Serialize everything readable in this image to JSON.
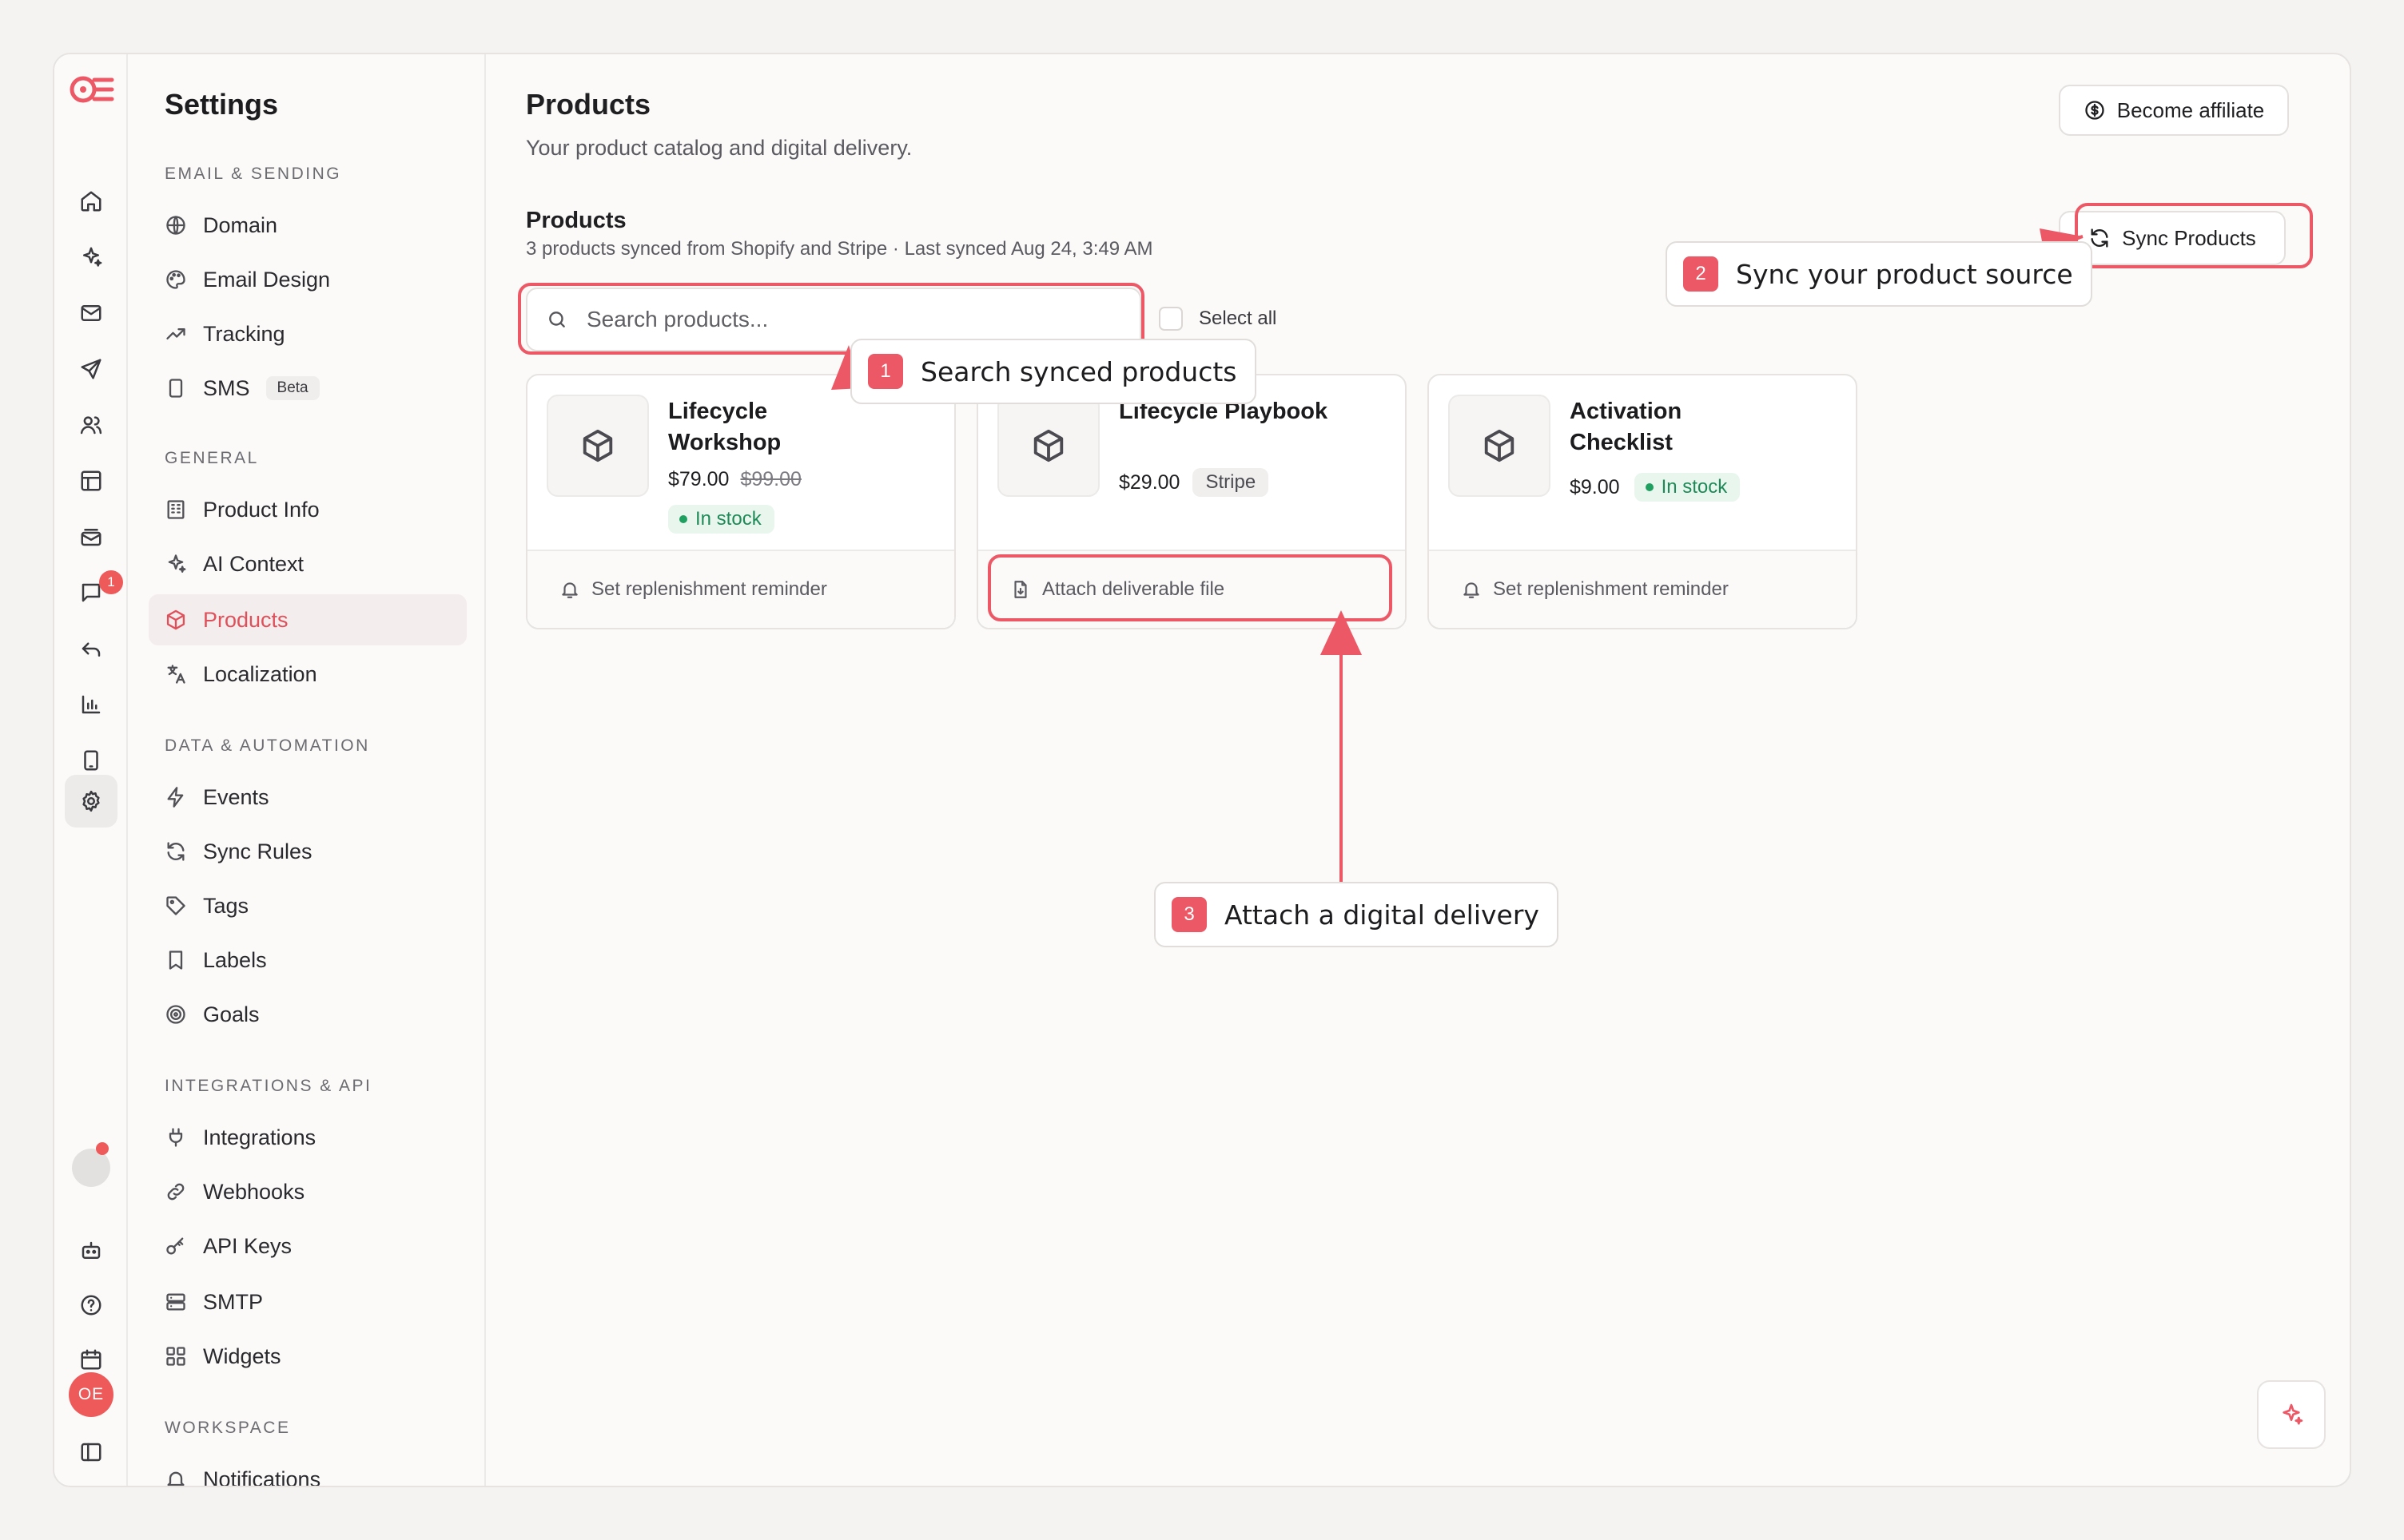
{
  "rail": {
    "badge_count": "1",
    "avatar_initials": "OE",
    "icons": [
      "home-icon",
      "sparkles-icon",
      "mail-icon",
      "send-icon",
      "users-icon",
      "layout-icon",
      "mail-stack-icon",
      "chat-icon",
      "reply-icon",
      "bar-chart-icon",
      "mobile-icon",
      "gear-icon"
    ]
  },
  "settings": {
    "title": "Settings",
    "sections": [
      {
        "label": "EMAIL & SENDING",
        "items": [
          {
            "label": "Domain",
            "icon": "globe-icon"
          },
          {
            "label": "Email Design",
            "icon": "palette-icon"
          },
          {
            "label": "Tracking",
            "icon": "trend-icon"
          },
          {
            "label": "SMS",
            "icon": "phone-icon",
            "badge": "Beta"
          }
        ]
      },
      {
        "label": "GENERAL",
        "items": [
          {
            "label": "Product Info",
            "icon": "building-icon"
          },
          {
            "label": "AI Context",
            "icon": "sparkles-icon"
          },
          {
            "label": "Products",
            "icon": "box-icon",
            "active": true
          },
          {
            "label": "Localization",
            "icon": "translate-icon"
          }
        ]
      },
      {
        "label": "DATA & AUTOMATION",
        "items": [
          {
            "label": "Events",
            "icon": "bolt-icon"
          },
          {
            "label": "Sync Rules",
            "icon": "refresh-icon"
          },
          {
            "label": "Tags",
            "icon": "tag-icon"
          },
          {
            "label": "Labels",
            "icon": "bookmark-icon"
          },
          {
            "label": "Goals",
            "icon": "target-icon"
          }
        ]
      },
      {
        "label": "INTEGRATIONS & API",
        "items": [
          {
            "label": "Integrations",
            "icon": "plug-icon"
          },
          {
            "label": "Webhooks",
            "icon": "link-icon"
          },
          {
            "label": "API Keys",
            "icon": "key-icon"
          },
          {
            "label": "SMTP",
            "icon": "server-icon"
          },
          {
            "label": "Widgets",
            "icon": "grid-icon"
          }
        ]
      },
      {
        "label": "WORKSPACE",
        "items": [
          {
            "label": "Notifications",
            "icon": "bell-icon"
          }
        ]
      }
    ]
  },
  "page": {
    "title": "Products",
    "subtitle": "Your product catalog and digital delivery.",
    "affiliate_label": "Become affiliate",
    "section_title": "Products",
    "section_sub": "3 products synced from Shopify and Stripe · Last synced Aug 24, 3:49 AM",
    "sync_label": "Sync Products",
    "search_placeholder": "Search products...",
    "select_all": "Select all"
  },
  "products": [
    {
      "name": "Lifecycle Workshop",
      "price": "$79.00",
      "old_price": "$99.00",
      "stock": "In stock",
      "action": "Set replenishment reminder",
      "action_icon": "bell-icon"
    },
    {
      "name": "Lifecycle Playbook",
      "price": "$29.00",
      "source": "Stripe",
      "action": "Attach deliverable file",
      "action_icon": "file-icon"
    },
    {
      "name": "Activation Checklist",
      "price": "$9.00",
      "stock": "In stock",
      "action": "Set replenishment reminder",
      "action_icon": "bell-icon"
    }
  ],
  "annotations": [
    {
      "num": "1",
      "text": "Search synced products"
    },
    {
      "num": "2",
      "text": "Sync your product source"
    },
    {
      "num": "3",
      "text": "Attach a digital delivery"
    }
  ],
  "colors": {
    "accent": "#ec5865",
    "stock": "#1f8a57",
    "badge": "#ee5a5a"
  }
}
